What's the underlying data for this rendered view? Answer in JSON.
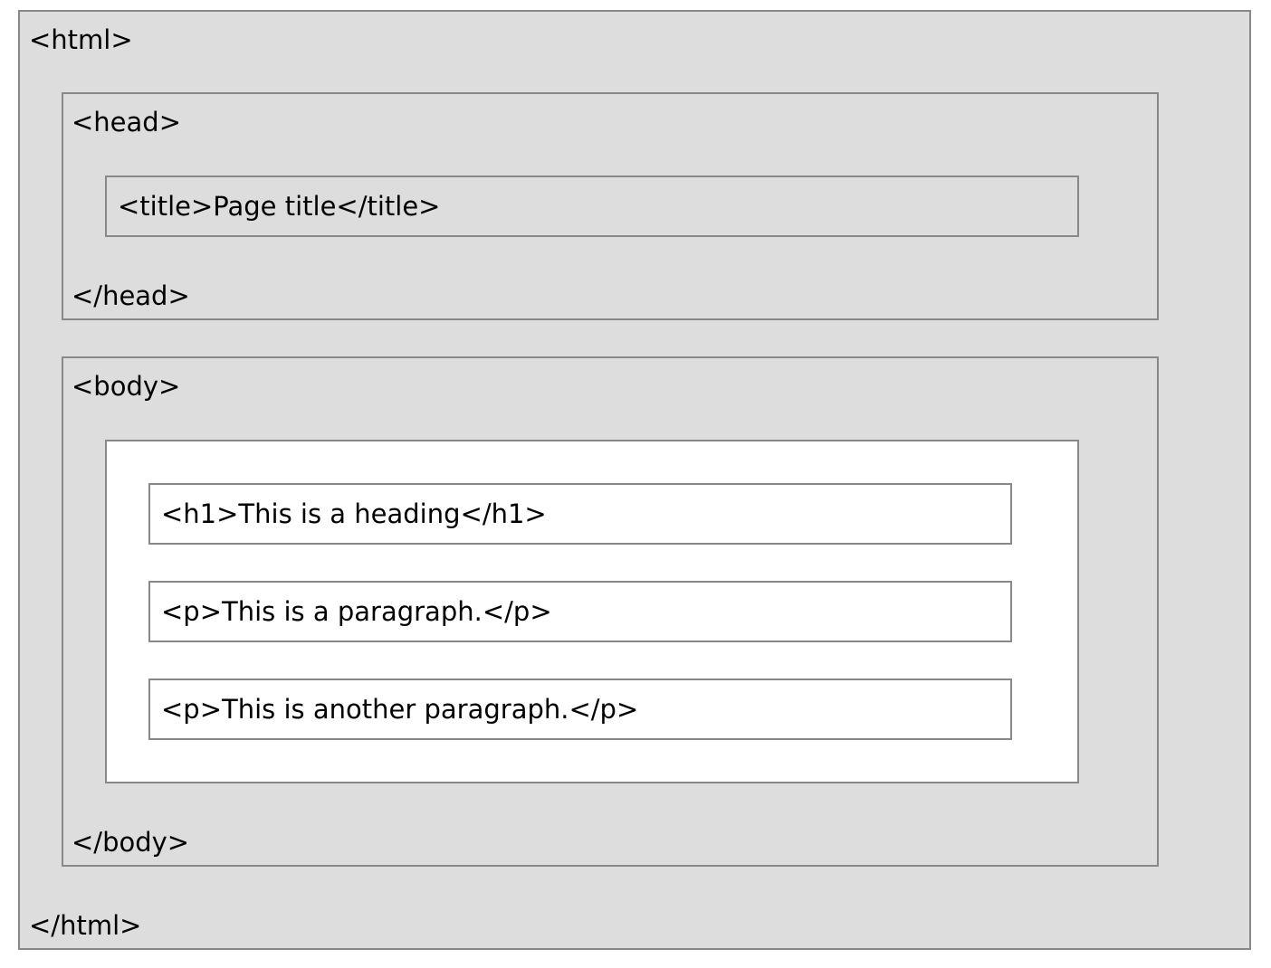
{
  "html": {
    "open": "<html>",
    "close": "</html>",
    "head": {
      "open": "<head>",
      "close": "</head>",
      "title": "<title>Page title</title>"
    },
    "body": {
      "open": "<body>",
      "close": "</body>",
      "elements": [
        "<h1>This is a heading</h1>",
        "<p>This is a paragraph.</p>",
        "<p>This is another paragraph.</p>"
      ]
    }
  },
  "colors": {
    "container_fill": "#dddddd",
    "content_fill": "#ffffff",
    "border": "#888888"
  }
}
